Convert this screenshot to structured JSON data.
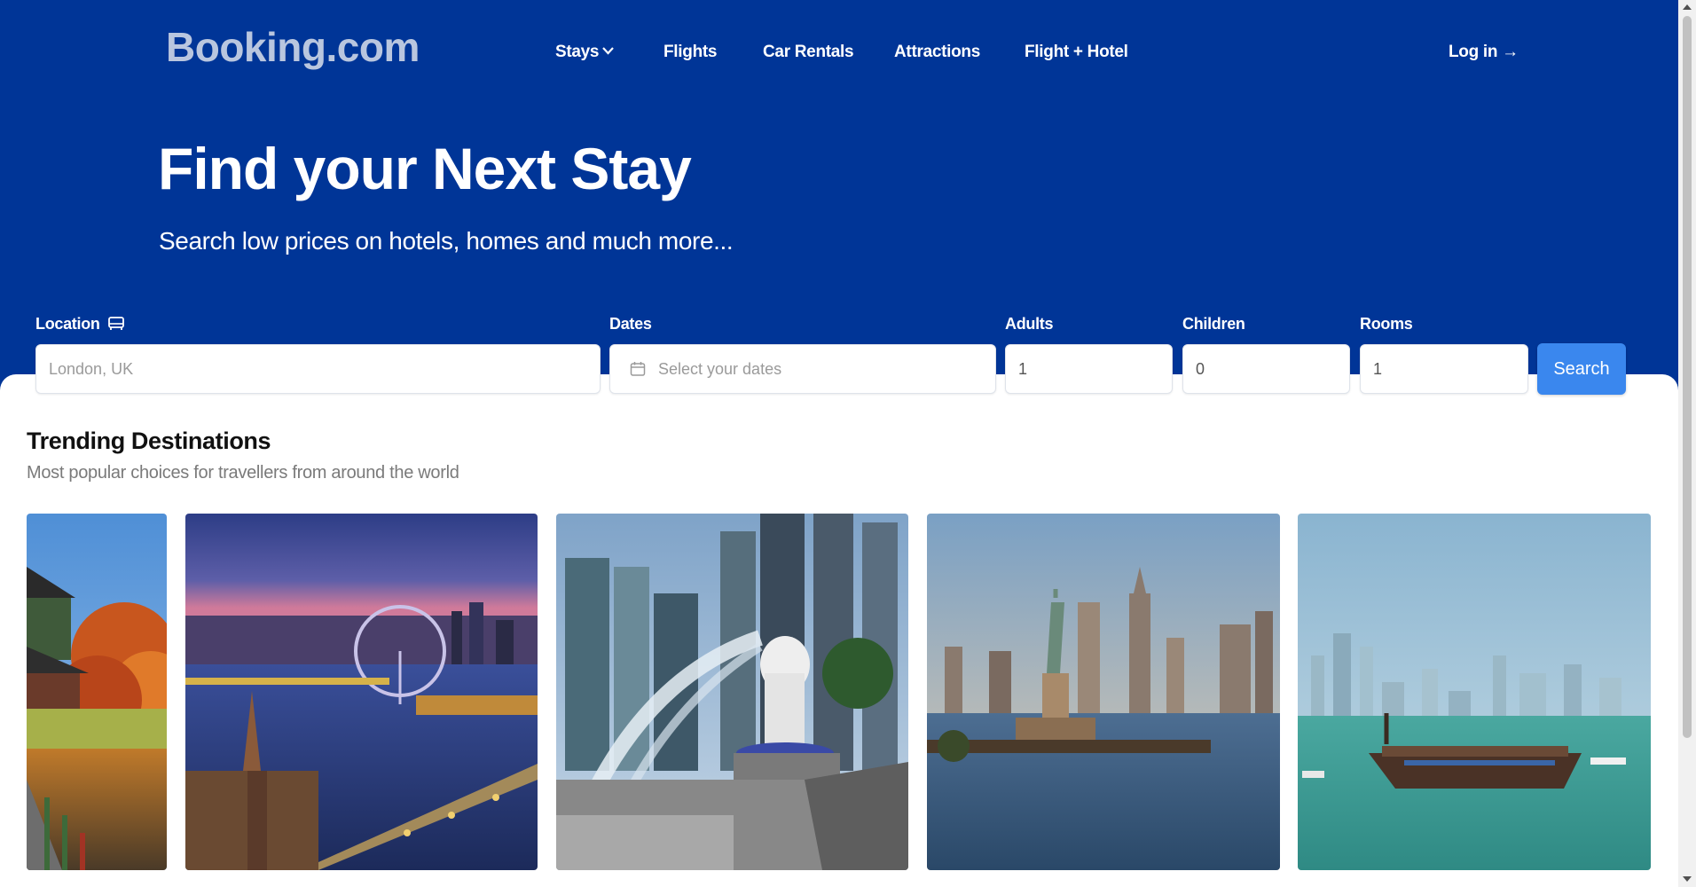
{
  "header": {
    "logo": "Booking.com",
    "nav": [
      {
        "label": "Stays",
        "has_dropdown": true
      },
      {
        "label": "Flights"
      },
      {
        "label": "Car Rentals"
      },
      {
        "label": "Attractions"
      },
      {
        "label": "Flight + Hotel"
      }
    ],
    "login_label": "Log in →"
  },
  "hero": {
    "title": "Find your Next Stay",
    "subtitle": "Search low prices on hotels, homes and much more..."
  },
  "search": {
    "location_label": "Location",
    "location_placeholder": "London, UK",
    "dates_label": "Dates",
    "dates_placeholder": "Select your dates",
    "adults_label": "Adults",
    "adults_value": "1",
    "children_label": "Children",
    "children_value": "0",
    "rooms_label": "Rooms",
    "rooms_value": "1",
    "search_label": "Search"
  },
  "trending": {
    "title": "Trending Destinations",
    "subtitle": "Most popular choices for travellers from around the world",
    "destinations": [
      {
        "icon": "seoul-palace-photo"
      },
      {
        "icon": "london-eye-photo"
      },
      {
        "icon": "singapore-merlion-photo"
      },
      {
        "icon": "new-york-liberty-photo"
      },
      {
        "icon": "doha-dhow-photo"
      }
    ]
  },
  "colors": {
    "hero_bg": "#003597",
    "search_button": "#3a87ee",
    "logo": "#b9c6df"
  }
}
